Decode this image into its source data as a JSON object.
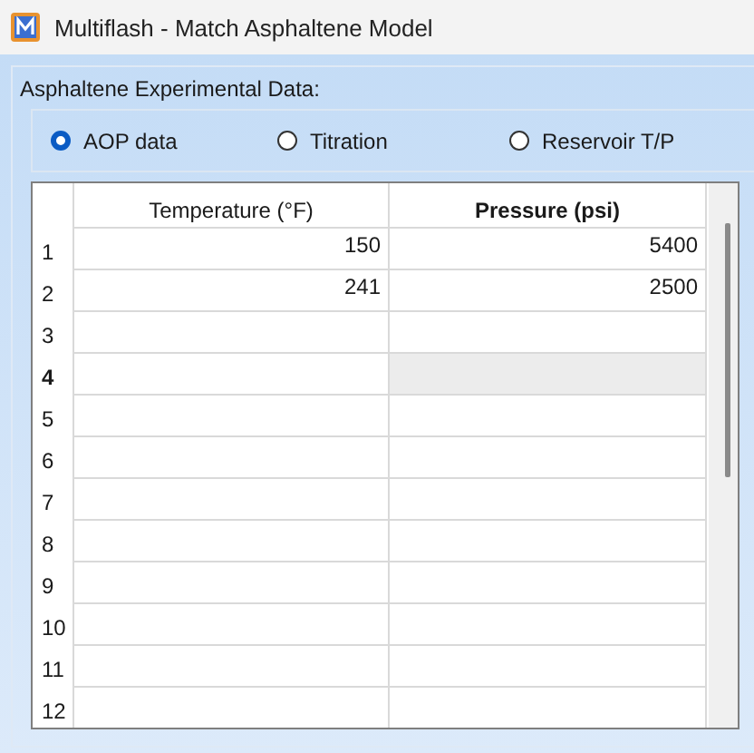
{
  "window": {
    "title": "Multiflash - Match Asphaltene Model"
  },
  "group": {
    "label": "Asphaltene Experimental Data:"
  },
  "options": [
    {
      "label": "AOP data",
      "selected": true
    },
    {
      "label": "Titration",
      "selected": false
    },
    {
      "label": "Reservoir T/P",
      "selected": false
    }
  ],
  "table": {
    "columns": [
      {
        "label": "Temperature (°F)",
        "selected": false
      },
      {
        "label": "Pressure (psi)",
        "selected": true
      }
    ],
    "rows": [
      {
        "number": "1",
        "selected": false,
        "cells": [
          "150",
          "5400"
        ]
      },
      {
        "number": "2",
        "selected": false,
        "cells": [
          "241",
          "2500"
        ]
      },
      {
        "number": "3",
        "selected": false,
        "cells": [
          "",
          ""
        ]
      },
      {
        "number": "4",
        "selected": true,
        "cells": [
          "",
          ""
        ]
      },
      {
        "number": "5",
        "selected": false,
        "cells": [
          "",
          ""
        ]
      },
      {
        "number": "6",
        "selected": false,
        "cells": [
          "",
          ""
        ]
      },
      {
        "number": "7",
        "selected": false,
        "cells": [
          "",
          ""
        ]
      },
      {
        "number": "8",
        "selected": false,
        "cells": [
          "",
          ""
        ]
      },
      {
        "number": "9",
        "selected": false,
        "cells": [
          "",
          ""
        ]
      },
      {
        "number": "10",
        "selected": false,
        "cells": [
          "",
          ""
        ]
      },
      {
        "number": "11",
        "selected": false,
        "cells": [
          "",
          ""
        ]
      },
      {
        "number": "12",
        "selected": false,
        "cells": [
          "",
          ""
        ]
      }
    ]
  }
}
